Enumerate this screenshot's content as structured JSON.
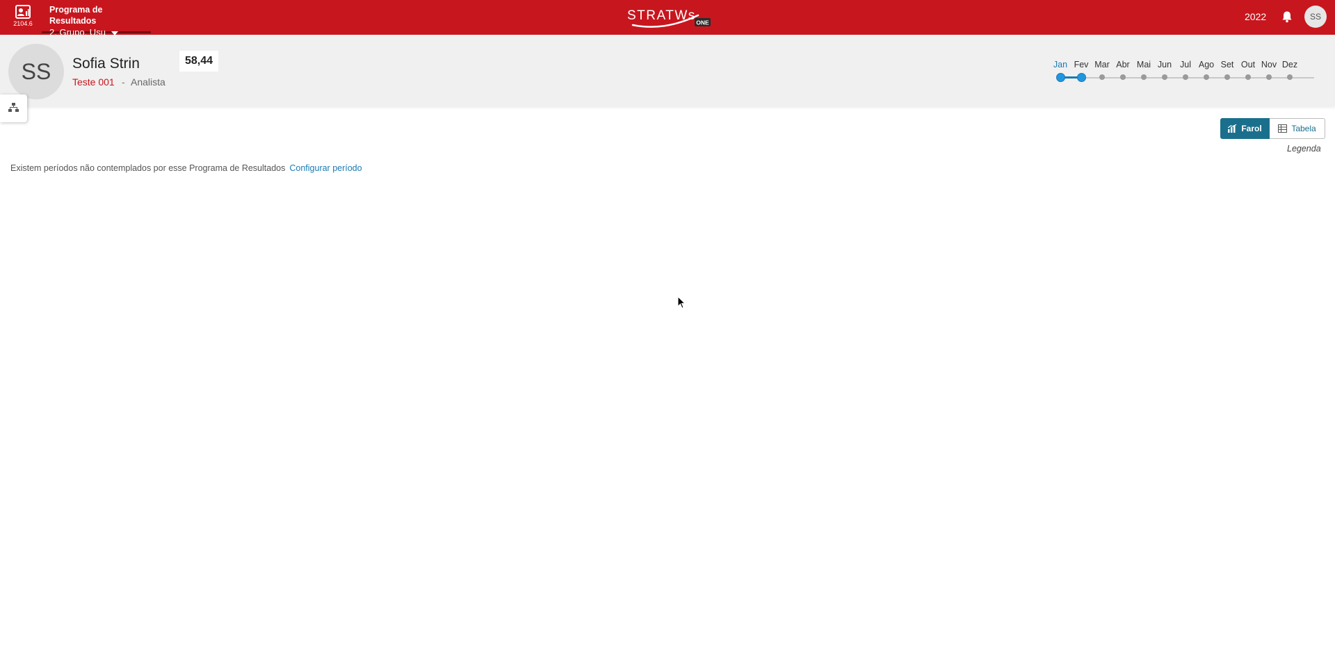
{
  "app": {
    "version": "2104.6",
    "program_title": "Programa de Resultados",
    "program_group": "2. Grupo, Usu",
    "logo_text": "STRATWs",
    "logo_badge": "ONE",
    "year": "2022",
    "user_initials": "SS"
  },
  "profile": {
    "initials": "SS",
    "name": "Sofia Strin",
    "team": "Teste 001",
    "separator": "-",
    "role": "Analista",
    "score": "58,44"
  },
  "timeline": {
    "months": [
      "Jan",
      "Fev",
      "Mar",
      "Abr",
      "Mai",
      "Jun",
      "Jul",
      "Ago",
      "Set",
      "Out",
      "Nov",
      "Dez"
    ],
    "selected_range": [
      "Jan",
      "Fev"
    ],
    "active_color": "#1a7ab5"
  },
  "view_toggle": {
    "farol_label": "Farol",
    "tabela_label": "Tabela",
    "active": "Farol"
  },
  "legend_label": "Legenda",
  "notice": {
    "text": "Existem períodos não contemplados por esse Programa de Resultados",
    "link_label": "Configurar período"
  },
  "colors": {
    "brand": "#c8161e",
    "accent": "#1a6f8c",
    "link": "#1a7ab5"
  },
  "icons": {
    "app": "user-report-icon",
    "notifications": "bell-icon",
    "side_tab": "org-chart-icon",
    "farol": "bar-chart-icon",
    "tabela": "table-icon"
  }
}
